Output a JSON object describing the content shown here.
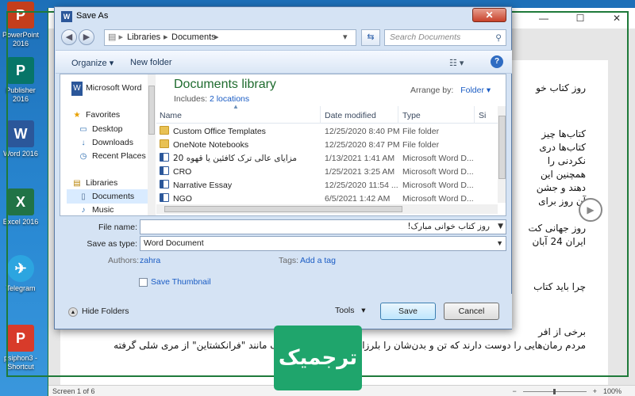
{
  "desktop": {
    "icons": [
      {
        "label": "PowerPoint 2016",
        "glyph": "P",
        "color": "#c43e1c"
      },
      {
        "label": "Publisher 2016",
        "glyph": "P",
        "color": "#077568"
      },
      {
        "label": "Word 2016",
        "glyph": "W",
        "color": "#2b579a"
      },
      {
        "label": "Excel 2016",
        "glyph": "X",
        "color": "#217346"
      },
      {
        "label": "Telegram",
        "glyph": "✈",
        "color": "#2ca5e0"
      },
      {
        "label": "psiphon3 - Shortcut",
        "glyph": "P",
        "color": "#d83b2a"
      }
    ]
  },
  "word": {
    "window_controls": [
      "—",
      "☐",
      "✕"
    ],
    "doc_lines": [
      "روز کتاب خو",
      "کتاب‌ها چیز",
      "کتاب‌ها دری",
      "نکردنی را",
      "همچنین این",
      "دهند و جشن",
      "آن روز برای",
      "روز جهانی کت",
      "ایران 24 آبان",
      "چرا باید کتاب",
      "برخی از افر",
      "مردم رمان‌هایی را دوست دارند که تن و بدن‌شان را بلرزانند از رمان‌های ترسناک مانند \"فرانکشتاین\" از مری شلی گرفته"
    ],
    "status": {
      "page": "Screen 1 of 6",
      "zoom": "100%"
    }
  },
  "brand": {
    "text": "ترجمیک",
    "color": "#1fa56c"
  },
  "dialog": {
    "title": "Save As",
    "app_icon": "W",
    "close": "✕",
    "breadcrumb": [
      "Libraries",
      "Documents"
    ],
    "search_placeholder": "Search Documents",
    "toolbar": {
      "organize": "Organize",
      "new_folder": "New folder"
    },
    "nav_items": [
      {
        "label": "Microsoft Word",
        "icon": "word-icon",
        "glyph": "W"
      },
      {
        "label": "Favorites",
        "icon": "star-icon",
        "glyph": "★"
      },
      {
        "label": "Desktop",
        "icon": "desktop-icon",
        "glyph": "▭"
      },
      {
        "label": "Downloads",
        "icon": "downloads-icon",
        "glyph": "↓"
      },
      {
        "label": "Recent Places",
        "icon": "recent-places-icon",
        "glyph": "◷"
      },
      {
        "label": "Libraries",
        "icon": "library-icon",
        "glyph": "▤"
      },
      {
        "label": "Documents",
        "icon": "documents-icon",
        "glyph": "▯"
      },
      {
        "label": "Music",
        "icon": "music-icon",
        "glyph": "♪"
      }
    ],
    "library": {
      "title": "Documents library",
      "includes_label": "Includes:",
      "includes_link": "2 locations",
      "arrange_label": "Arrange by:",
      "arrange_value": "Folder"
    },
    "columns": [
      "Name",
      "Date modified",
      "Type",
      "Si"
    ],
    "files": [
      {
        "name": "Custom Office Templates",
        "date": "12/25/2020 8:40 PM",
        "type": "File folder",
        "kind": "folder"
      },
      {
        "name": "OneNote Notebooks",
        "date": "12/25/2020 8:47 PM",
        "type": "File folder",
        "kind": "folder"
      },
      {
        "name": "مزایای عالی ترک کافئین یا قهوه 20",
        "date": "1/13/2021 1:41 AM",
        "type": "Microsoft Word D...",
        "kind": "doc"
      },
      {
        "name": "CRO",
        "date": "1/25/2021 3:25 AM",
        "type": "Microsoft Word D...",
        "kind": "doc"
      },
      {
        "name": "Narrative Essay",
        "date": "12/25/2020 11:54 ...",
        "type": "Microsoft Word D...",
        "kind": "doc"
      },
      {
        "name": "NGO",
        "date": "6/5/2021 1:42 AM",
        "type": "Microsoft Word D...",
        "kind": "doc"
      }
    ],
    "form": {
      "file_name_label": "File name:",
      "file_name_value": "روز کتاب خوانی مبارک!",
      "save_type_label": "Save as type:",
      "save_type_value": "Word Document",
      "authors_label": "Authors:",
      "authors_value": "zahra",
      "tags_label": "Tags:",
      "tags_value": "Add a tag",
      "thumbnail_label": "Save Thumbnail",
      "thumbnail_checked": false
    },
    "bottom": {
      "hide_folders": "Hide Folders",
      "tools": "Tools",
      "save": "Save",
      "cancel": "Cancel"
    }
  }
}
